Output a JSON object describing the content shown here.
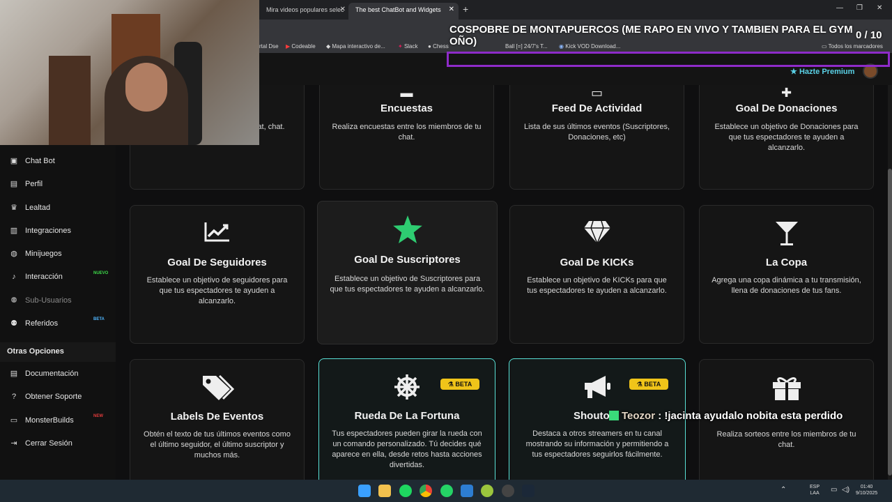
{
  "browser": {
    "tabs": [
      {
        "label": "Mira videos populares selec"
      },
      {
        "label": "The best ChatBot and Widgets"
      }
    ],
    "bookmarks": [
      "rtal Dse",
      "Codeable",
      "Mapa interactivo de...",
      "Slack",
      "Chess",
      "Ball [=] 24/7's T...",
      "Kick VOD Download...",
      "Todos los marcadores"
    ]
  },
  "overlay": {
    "stream_title": "COSPOBRE DE MONTAPUERCOS (ME RAPO EN VIVO Y TAMBIEN PARA EL GYM OÑO)",
    "counter": "0 / 10",
    "chat_user": "Teozor",
    "chat_message": ": !jacinta ayudalo nobita esta perdido"
  },
  "header": {
    "premium_label": "Hazte Premium"
  },
  "sidebar": {
    "items": [
      {
        "label": "Chat Bot",
        "icon": "robot-icon"
      },
      {
        "label": "Perfil",
        "icon": "id-card-icon"
      },
      {
        "label": "Lealtad",
        "icon": "trophy-icon"
      },
      {
        "label": "Integraciones",
        "icon": "puzzle-icon"
      },
      {
        "label": "Minijuegos",
        "icon": "gamepad-icon"
      },
      {
        "label": "Interacción",
        "icon": "music-icon",
        "tag": "NUEVO",
        "tag_color": "#3ddc4a"
      },
      {
        "label": "Sub-Usuarios",
        "icon": "users-icon"
      },
      {
        "label": "Referidos",
        "icon": "users-icon",
        "tag": "BETA",
        "tag_color": "#4fb6ff"
      }
    ],
    "other_section": "Otras Opciones",
    "other_items": [
      {
        "label": "Documentación",
        "icon": "book-icon"
      },
      {
        "label": "Obtener Soporte",
        "icon": "help-icon"
      },
      {
        "label": "MonsterBuilds",
        "icon": "laptop-icon",
        "tag": "NEW",
        "tag_color": "#e23b3b"
      },
      {
        "label": "Cerrar Sesión",
        "icon": "logout-icon"
      }
    ]
  },
  "cards": [
    {
      "title": "",
      "desc": "n el chat, chat."
    },
    {
      "title": "Encuestas",
      "desc": "Realiza encuestas entre los miembros de tu chat."
    },
    {
      "title": "Feed De Actividad",
      "desc": "Lista de sus últimos eventos (Suscriptores, Donaciones, etc)"
    },
    {
      "title": "Goal De Donaciones",
      "desc": "Establece un objetivo de Donaciones para que tus espectadores te ayuden a alcanzarlo."
    },
    {
      "title": "Goal De Seguidores",
      "desc": "Establece un objetivo de seguidores para que tus espectadores te ayuden a alcanzarlo."
    },
    {
      "title": "Goal De Suscriptores",
      "desc": "Establece un objetivo de Suscriptores para que tus espectadores te ayuden a alcanzarlo."
    },
    {
      "title": "Goal De KICKs",
      "desc": "Establece un objetivo de KICKs para que tus espectadores te ayuden a alcanzarlo."
    },
    {
      "title": "La Copa",
      "desc": "Agrega una copa dinámica a tu transmisión, llena de donaciones de tus fans."
    },
    {
      "title": "Labels De Eventos",
      "desc": "Obtén el texto de tus últimos eventos como el último seguidor, el último suscriptor y muchos más."
    },
    {
      "title": "Rueda De La Fortuna",
      "desc": "Tus espectadores pueden girar la rueda con un comando personalizado. Tú decides qué aparece en ella, desde retos hasta acciones divertidas.",
      "badge": "BETA"
    },
    {
      "title": "Shouto",
      "desc": "Destaca a otros streamers en tu canal mostrando su información y permitiendo a tus espectadores seguirlos fácilmente.",
      "badge": "BETA"
    },
    {
      "title": "",
      "desc": "Realiza sorteos entre los miembros de tu chat."
    }
  ],
  "taskbar": {
    "lang": "ESP",
    "lang2": "LAA",
    "time": "01:40",
    "date": "9/10/2025"
  },
  "colors": {
    "accent": "#59e1d6",
    "star": "#2ecc71",
    "beta_badge": "#f0c419",
    "purple_bar": "#8e2bc9"
  }
}
